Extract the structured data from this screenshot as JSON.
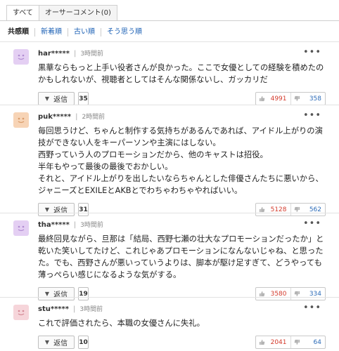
{
  "tabs": [
    {
      "label": "すべて"
    },
    {
      "label": "オーサーコメント(0)"
    }
  ],
  "sort": [
    {
      "label": "共感順"
    },
    {
      "label": "新着順"
    },
    {
      "label": "古い順"
    },
    {
      "label": "そう思う順"
    }
  ],
  "icons": {
    "more": "more-options-icon",
    "reply_caret": "caret-down-icon",
    "good": "thumbs-up-icon",
    "bad": "thumbs-down-icon"
  },
  "labels": {
    "more": "•••",
    "reply_caret": "▼",
    "reply": "返信"
  },
  "comments": [
    {
      "user": "har*****",
      "time": "3時間前",
      "avatar_color": "#e4cff3",
      "face_color": "#b08bd1",
      "lines": [
        "黒華ならもっと上手い役者さんが良かった。ここで女優としての経験を積めたの",
        "かもしれないが、視聴者としてはそんな関係ないし、ガッカリだ"
      ],
      "reply_count": "35",
      "good": "4991",
      "bad": "358"
    },
    {
      "user": "puk*****",
      "time": "2時間前",
      "avatar_color": "#f7d4b6",
      "face_color": "#d99a68",
      "lines": [
        "毎回思うけど、ちゃんと制作する気持ちがあるんであれば、アイドル上がりの演",
        "技ができない人をキーパーソンや主演にはしない。",
        "西野っていう人のプロモーションだから、他のキャストは招役。",
        "半年もやって最後の最後でおかしい。",
        "それと、アイドル上がりを出したいならちゃんとした俳優さんたちに悪いから、",
        "ジャニーズとEXILEとAKBとでわちゃわちゃやればいい。"
      ],
      "reply_count": "31",
      "good": "5128",
      "bad": "562"
    },
    {
      "user": "tha*****",
      "time": "3時間前",
      "avatar_color": "#e4cff3",
      "face_color": "#b08bd1",
      "lines": [
        "最終回見ながら、旦那は「結局、西野七瀬の壮大なプロモーションだったか」と",
        "乾いた笑いしてたけど、これじゃあプロモーションになんないじゃね、と思った",
        "た。でも、西野さんが悪いっていうよりは、脚本が駆け足すぎて、どうやっても",
        "薄っぺらい感じになるような気がする。"
      ],
      "reply_count": "19",
      "good": "3580",
      "bad": "334"
    },
    {
      "user": "stu*****",
      "time": "3時間前",
      "avatar_color": "#f6d5da",
      "face_color": "#d48a96",
      "lines": [
        "これで評価されたら、本職の女優さんに失礼。"
      ],
      "reply_count": "10",
      "good": "2041",
      "bad": "64"
    }
  ]
}
